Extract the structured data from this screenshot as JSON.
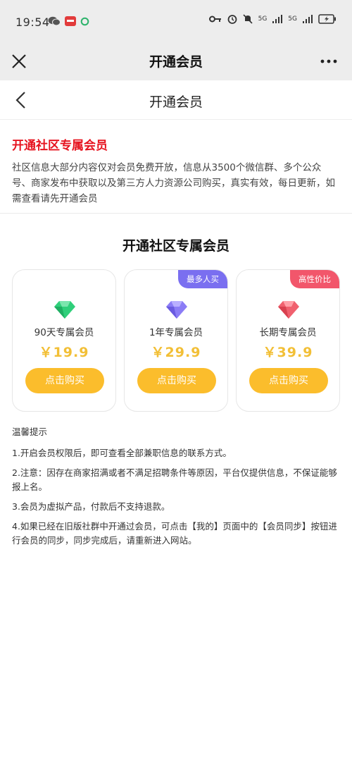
{
  "status_bar": {
    "time": "19:54",
    "network_1": "5G",
    "network_2": "5G"
  },
  "wechat_bar": {
    "title": "开通会员"
  },
  "page_nav": {
    "title": "开通会员"
  },
  "intro": {
    "title": "开通社区专属会员",
    "description": "社区信息大部分内容仅对会员免费开放，信息从3500个微信群、多个公众号、商家发布中获取以及第三方人力资源公司购买，真实有效，每日更新，如需查看请先开通会员"
  },
  "plans_section": {
    "title": "开通社区专属会员",
    "plans": [
      {
        "name": "90天专属会员",
        "price": "￥19.9",
        "button": "点击购买",
        "tag": "",
        "gem_color": "#2fcf7a"
      },
      {
        "name": "1年专属会员",
        "price": "￥29.9",
        "button": "点击购买",
        "tag": "最多人买",
        "tag_color": "#7a6ff0",
        "gem_color": "#8b7cf6"
      },
      {
        "name": "长期专属会员",
        "price": "￥39.9",
        "button": "点击购买",
        "tag": "高性价比",
        "tag_color": "#f2566b",
        "gem_color": "#f0606e"
      }
    ]
  },
  "tips": {
    "heading": "温馨提示",
    "items": [
      "1.开启会员权限后，即可查看全部兼职信息的联系方式。",
      "2.注意：因存在商家招满或者不满足招聘条件等原因，平台仅提供信息，不保证能够报上名。",
      "3.会员为虚拟产品，付款后不支持退款。",
      "4.如果已经在旧版社群中开通过会员，可点击【我的】页面中的【会员同步】按钮进行会员的同步，同步完成后，请重新进入网站。"
    ]
  }
}
